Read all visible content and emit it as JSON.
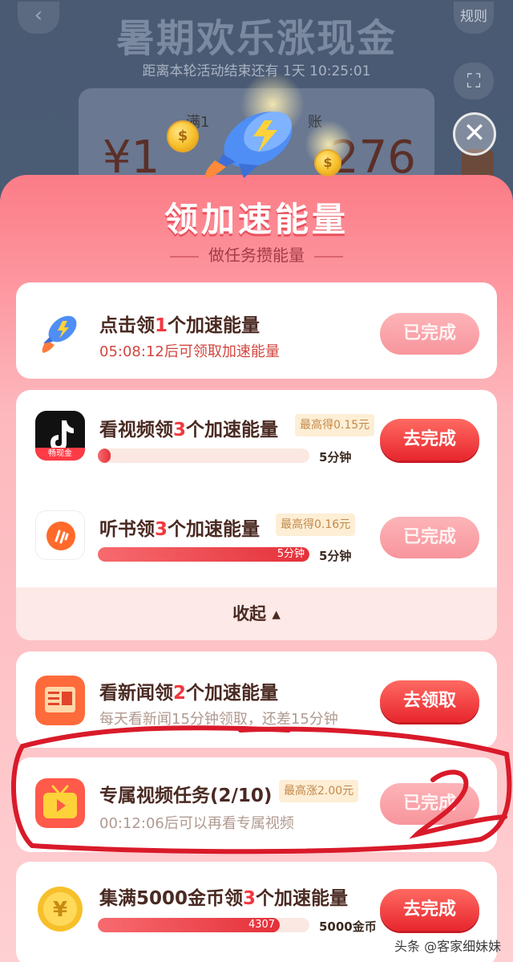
{
  "background": {
    "title": "暑期欢乐涨现金",
    "rules_label": "规则",
    "countdown": "距离本轮活动结束还有 1天 10:25:01",
    "card_label_left": "满1",
    "card_label_right": "账",
    "amount_left": "¥1",
    "amount_right": "276"
  },
  "modal": {
    "title": "领加速能量",
    "subtitle": "做任务攒能量"
  },
  "tasks": [
    {
      "icon": "rocket-icon",
      "title_pre": "点击领",
      "title_num": "1",
      "title_post": "个加速能量",
      "subtitle": "05:08:12后可领取加速能量",
      "button": "已完成",
      "button_state": "done"
    },
    {
      "icon": "douyin-icon",
      "icon_tag": "畅现金",
      "title_pre": "看视频领",
      "title_num": "3",
      "title_post": "个加速能量",
      "badge": "最高得0.15元",
      "progress": 0.06,
      "progress_label": "",
      "progress_end": "5分钟",
      "button": "去完成",
      "button_state": "go"
    },
    {
      "icon": "audiobook-icon",
      "title_pre": "听书领",
      "title_num": "3",
      "title_post": "个加速能量",
      "badge": "最高得0.16元",
      "progress": 1.0,
      "progress_label": "5分钟",
      "progress_end": "5分钟",
      "button": "已完成",
      "button_state": "done"
    },
    {
      "icon": "news-icon",
      "title_pre": "看新闻领",
      "title_num": "2",
      "title_post": "个加速能量",
      "subtitle": "每天看新闻15分钟领取，还差15分钟",
      "button": "去领取",
      "button_state": "go"
    },
    {
      "icon": "tv-icon",
      "title_pre": "专属视频任务(2/10)",
      "title_num": "",
      "title_post": "",
      "badge": "最高涨2.00元",
      "subtitle": "00:12:06后可以再看专属视频",
      "button": "已完成",
      "button_state": "done"
    },
    {
      "icon": "gold-coin-icon",
      "title_pre": "集满5000金币领",
      "title_num": "3",
      "title_post": "个加速能量",
      "progress": 0.86,
      "progress_label": "4307",
      "progress_end": "5000金币",
      "button": "去完成",
      "button_state": "go"
    }
  ],
  "collapse_label": "收起 ▴",
  "watermark": "头条 @客家细妹妹",
  "colors": {
    "accent_red": "#e8262e",
    "highlight_red": "#f2373e",
    "panel_pink": "#fb7c86",
    "annotation_red": "#d91a2a"
  }
}
